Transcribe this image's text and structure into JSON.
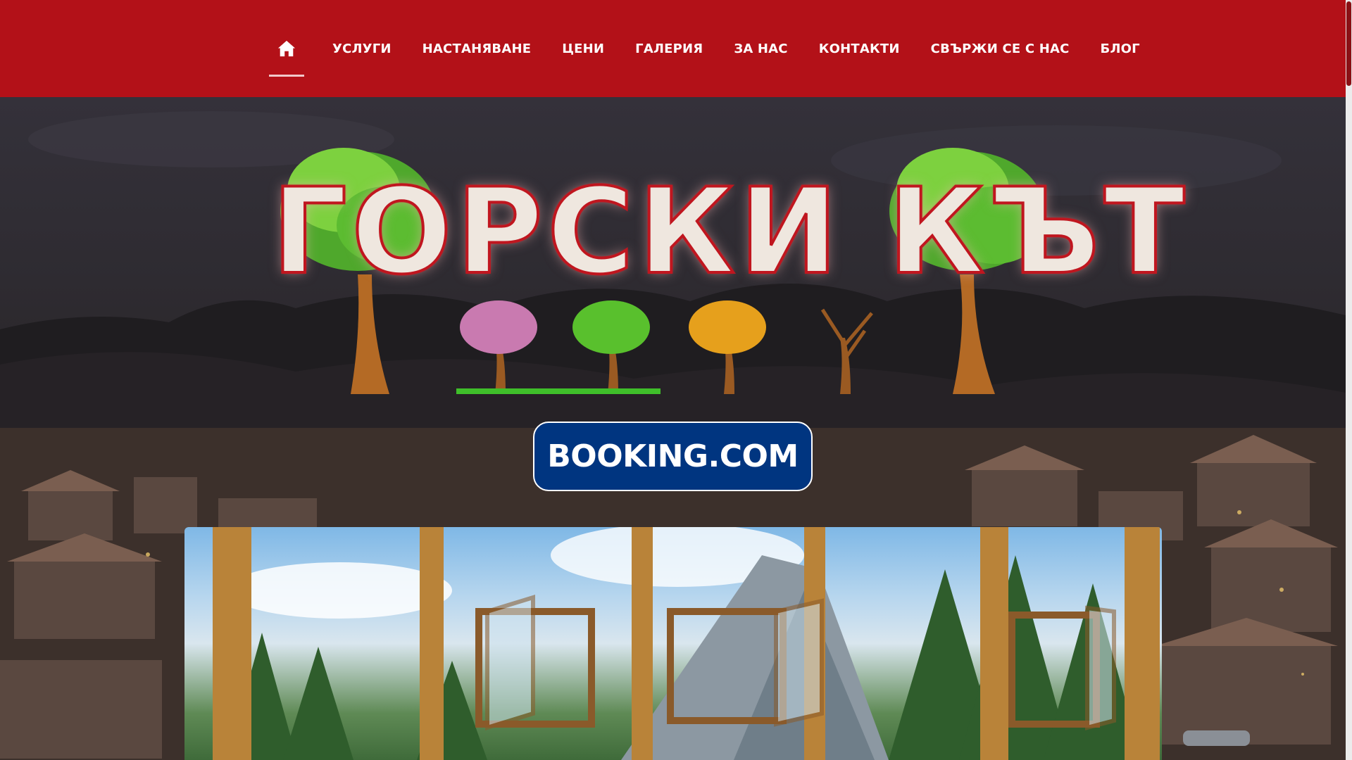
{
  "nav": {
    "home_icon": "home-icon",
    "items": [
      {
        "label": "УСЛУГИ"
      },
      {
        "label": "НАСТАНЯВАНЕ"
      },
      {
        "label": "ЦЕНИ"
      },
      {
        "label": "ГАЛЕРИЯ"
      },
      {
        "label": "ЗА НАС"
      },
      {
        "label": "КОНТАКТИ"
      },
      {
        "label": "СВЪРЖИ СЕ С НАС"
      },
      {
        "label": "БЛОГ"
      }
    ]
  },
  "logo": {
    "title": "ГОРСКИ КЪТ"
  },
  "booking": {
    "label": "BOOKING.COM"
  },
  "colors": {
    "nav_bg": "#b31118",
    "booking_bg": "#003580",
    "logo_outline": "#c0161f"
  }
}
